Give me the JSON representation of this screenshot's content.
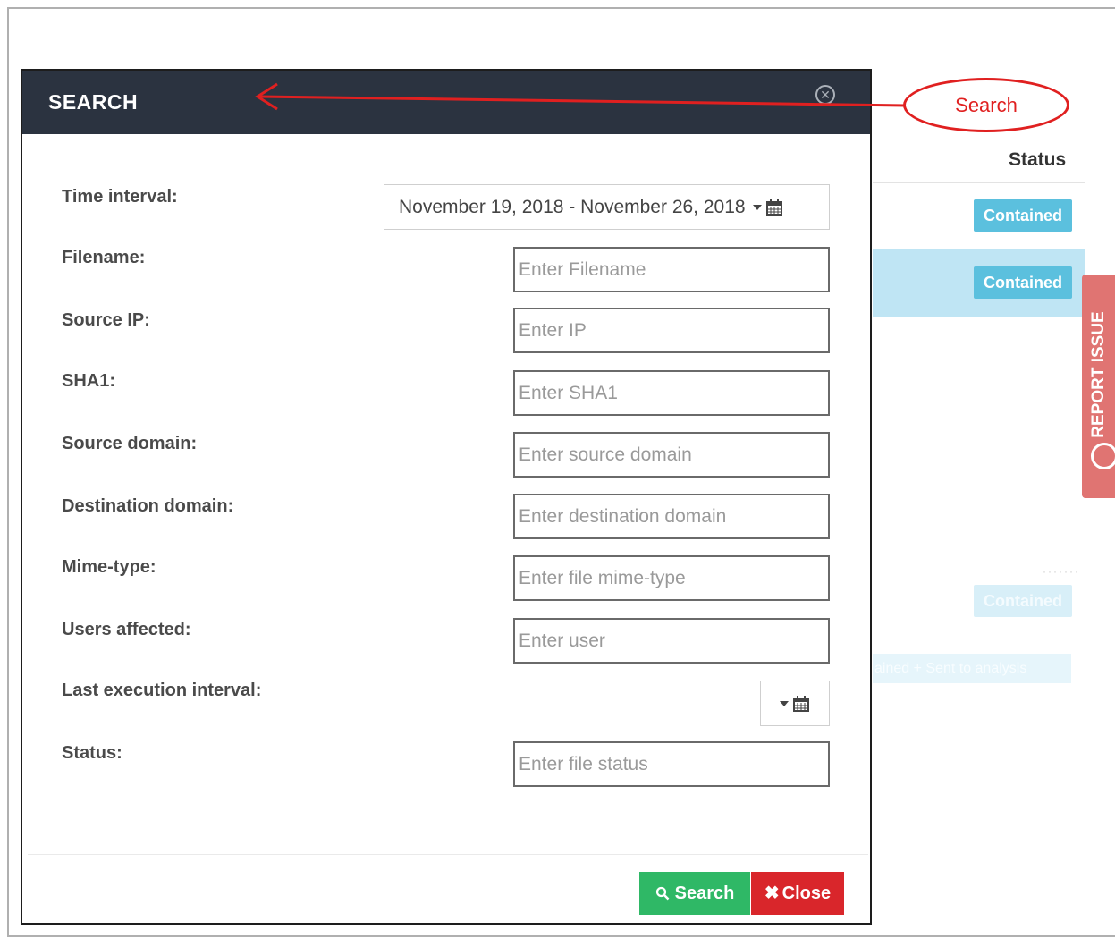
{
  "background": {
    "status_header": "Status",
    "badges": [
      "Contained",
      "Contained",
      "Contained"
    ],
    "faded_text": "ained + Sent to analysis",
    "report_tab_label": "REPORT ISSUE"
  },
  "annotation": {
    "callout_label": "Search",
    "color": "#e02020"
  },
  "modal": {
    "title": "SEARCH",
    "close_icon": "close-circle-icon",
    "fields": [
      {
        "label": "Time interval:",
        "type": "daterange",
        "value": "November 19, 2018 - November 26, 2018"
      },
      {
        "label": "Filename:",
        "placeholder": "Enter Filename"
      },
      {
        "label": "Source IP:",
        "placeholder": "Enter IP"
      },
      {
        "label": "SHA1:",
        "placeholder": "Enter SHA1"
      },
      {
        "label": "Source domain:",
        "placeholder": "Enter source domain"
      },
      {
        "label": "Destination domain:",
        "placeholder": "Enter destination domain"
      },
      {
        "label": "Mime-type:",
        "placeholder": "Enter file mime-type"
      },
      {
        "label": "Users affected:",
        "placeholder": "Enter user"
      },
      {
        "label": "Last execution interval:",
        "type": "daterange",
        "value": ""
      },
      {
        "label": "Status:",
        "placeholder": "Enter file status"
      }
    ],
    "buttons": {
      "search": "Search",
      "close": "Close"
    }
  },
  "colors": {
    "header_bg": "#2b3340",
    "search_btn": "#2fb866",
    "close_btn": "#d9262b",
    "badge": "#5bc0de",
    "report_tab": "#e07472"
  }
}
